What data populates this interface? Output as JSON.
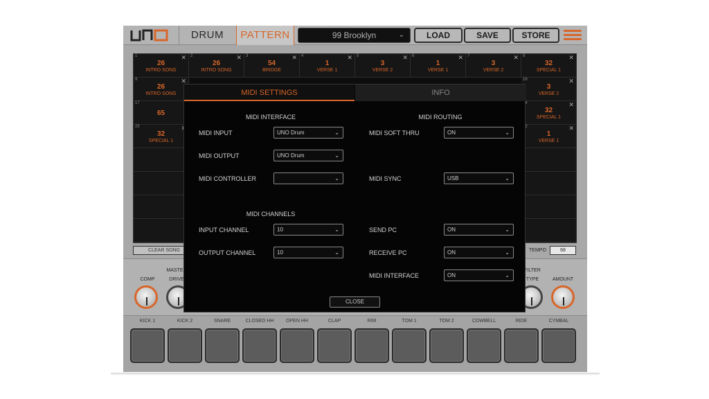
{
  "header": {
    "tab_drum": "DRUM",
    "tab_pattern": "PATTERN",
    "preset": "99 Brooklyn",
    "load": "LOAD",
    "save": "SAVE",
    "store": "STORE"
  },
  "grid": {
    "cells": [
      {
        "num": "1",
        "val": "26",
        "name": "INTRO SONG"
      },
      {
        "num": "2",
        "val": "26",
        "name": "INTRO SONG"
      },
      {
        "num": "3",
        "val": "54",
        "name": "BRIDGE"
      },
      {
        "num": "4",
        "val": "1",
        "name": "VERSE 1"
      },
      {
        "num": "5",
        "val": "3",
        "name": "VERSE 2"
      },
      {
        "num": "6",
        "val": "1",
        "name": "VERSE 1"
      },
      {
        "num": "7",
        "val": "3",
        "name": "VERSE 2"
      },
      {
        "num": "8",
        "val": "32",
        "name": "SPECIAL 1"
      },
      {
        "num": "9",
        "val": "26",
        "name": "INTRO SONG"
      },
      {
        "num": "16",
        "val": "3",
        "name": "VERSE 2"
      },
      {
        "num": "17",
        "val": "65",
        "name": ""
      },
      {
        "num": "24",
        "val": "32",
        "name": "SPECIAL 1"
      },
      {
        "num": "25",
        "val": "32",
        "name": "SPECIAL 1"
      },
      {
        "num": "32",
        "val": "1",
        "name": "VERSE 1"
      }
    ],
    "clear_label": "CLEAR SONG",
    "tempo_label": "TEMPO",
    "tempo_value": "68"
  },
  "knobs": {
    "comp": "COMP",
    "master": "MASTER",
    "drive": "DRIVE",
    "filter": "FILTER",
    "type": "TYPE",
    "amount": "AMOUNT"
  },
  "pads": [
    "KICK 1",
    "KICK 2",
    "SNARE",
    "CLOSED HH",
    "OPEN HH",
    "CLAP",
    "RIM",
    "TOM 1",
    "TOM 2",
    "COWBELL",
    "RIDE",
    "CYMBAL"
  ],
  "modal": {
    "tab_midi": "MIDI SETTINGS",
    "tab_info": "INFO",
    "interface_title": "MIDI INTERFACE",
    "routing_title": "MIDI ROUTING",
    "channels_title": "MIDI CHANNELS",
    "midi_input_label": "MIDI INPUT",
    "midi_input_value": "UNO Drum",
    "midi_output_label": "MIDI OUTPUT",
    "midi_output_value": "UNO Drum",
    "midi_controller_label": "MIDI CONTROLLER",
    "midi_controller_value": "",
    "soft_thru_label": "MIDI SOFT THRU",
    "soft_thru_value": "ON",
    "sync_label": "MIDI SYNC",
    "sync_value": "USB",
    "input_channel_label": "INPUT CHANNEL",
    "input_channel_value": "10",
    "output_channel_label": "OUTPUT CHANNEL",
    "output_channel_value": "10",
    "send_pc_label": "SEND PC",
    "send_pc_value": "ON",
    "receive_pc_label": "RECEIVE PC",
    "receive_pc_value": "ON",
    "midi_interface_label": "MIDI INTERFACE",
    "midi_interface_value": "ON",
    "close": "CLOSE"
  },
  "colors": {
    "accent": "#d8662a",
    "modal_bg": "#050505"
  }
}
